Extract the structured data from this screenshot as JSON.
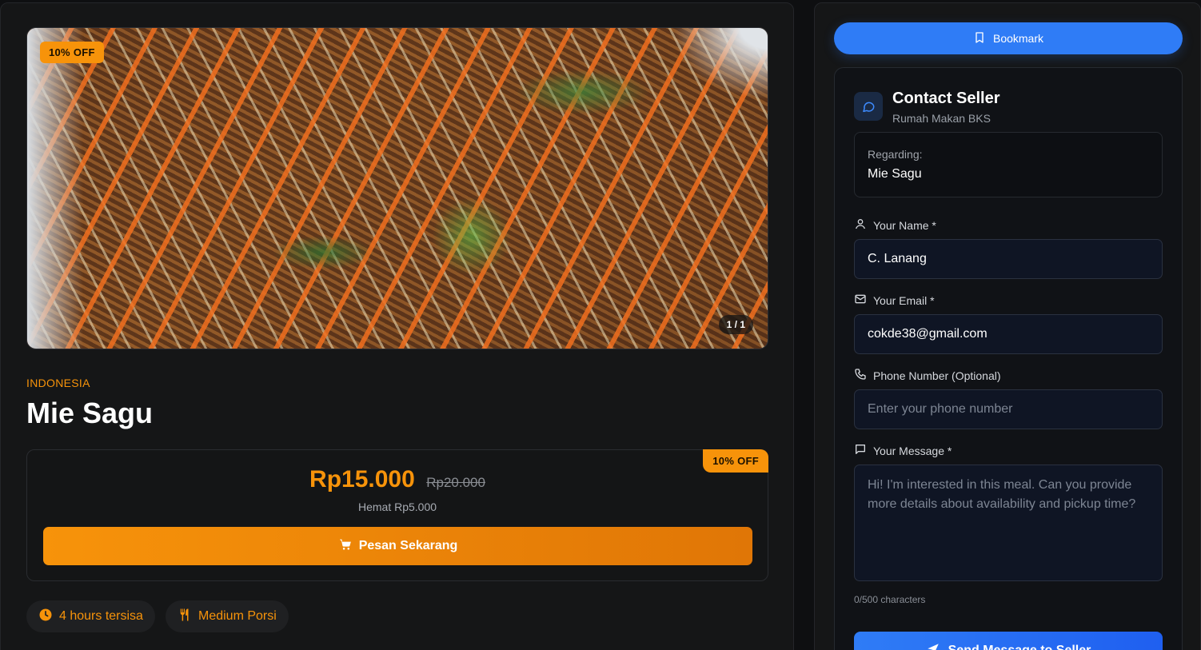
{
  "listing": {
    "discount_badge": "10% OFF",
    "image_counter": "1 / 1",
    "origin": "INDONESIA",
    "title": "Mie Sagu",
    "price_now": "Rp15.000",
    "price_old": "Rp20.000",
    "savings": "Hemat Rp5.000",
    "order_label": "Pesan Sekarang",
    "time_left": "4 hours tersisa",
    "portion": "Medium Porsi",
    "image_icon": "noodle-dish-photo"
  },
  "sidebar": {
    "bookmark_label": "Bookmark",
    "contact_title": "Contact Seller",
    "seller_name": "Rumah Makan BKS",
    "regarding_label": "Regarding:",
    "regarding_value": "Mie Sagu",
    "name_label": "Your Name *",
    "name_value": "C. Lanang",
    "email_label": "Your Email *",
    "email_value": "cokde38@gmail.com",
    "phone_label": "Phone Number (Optional)",
    "phone_placeholder": "Enter your phone number",
    "message_label": "Your Message *",
    "message_placeholder": "Hi! I'm interested in this meal. Can you provide more details about availability and pickup time?",
    "char_count": "0/500 characters",
    "send_label": "Send Message to Seller"
  },
  "colors": {
    "accent_orange": "#f7930a",
    "accent_blue": "#2f7cf6",
    "background": "#0e0f11"
  }
}
